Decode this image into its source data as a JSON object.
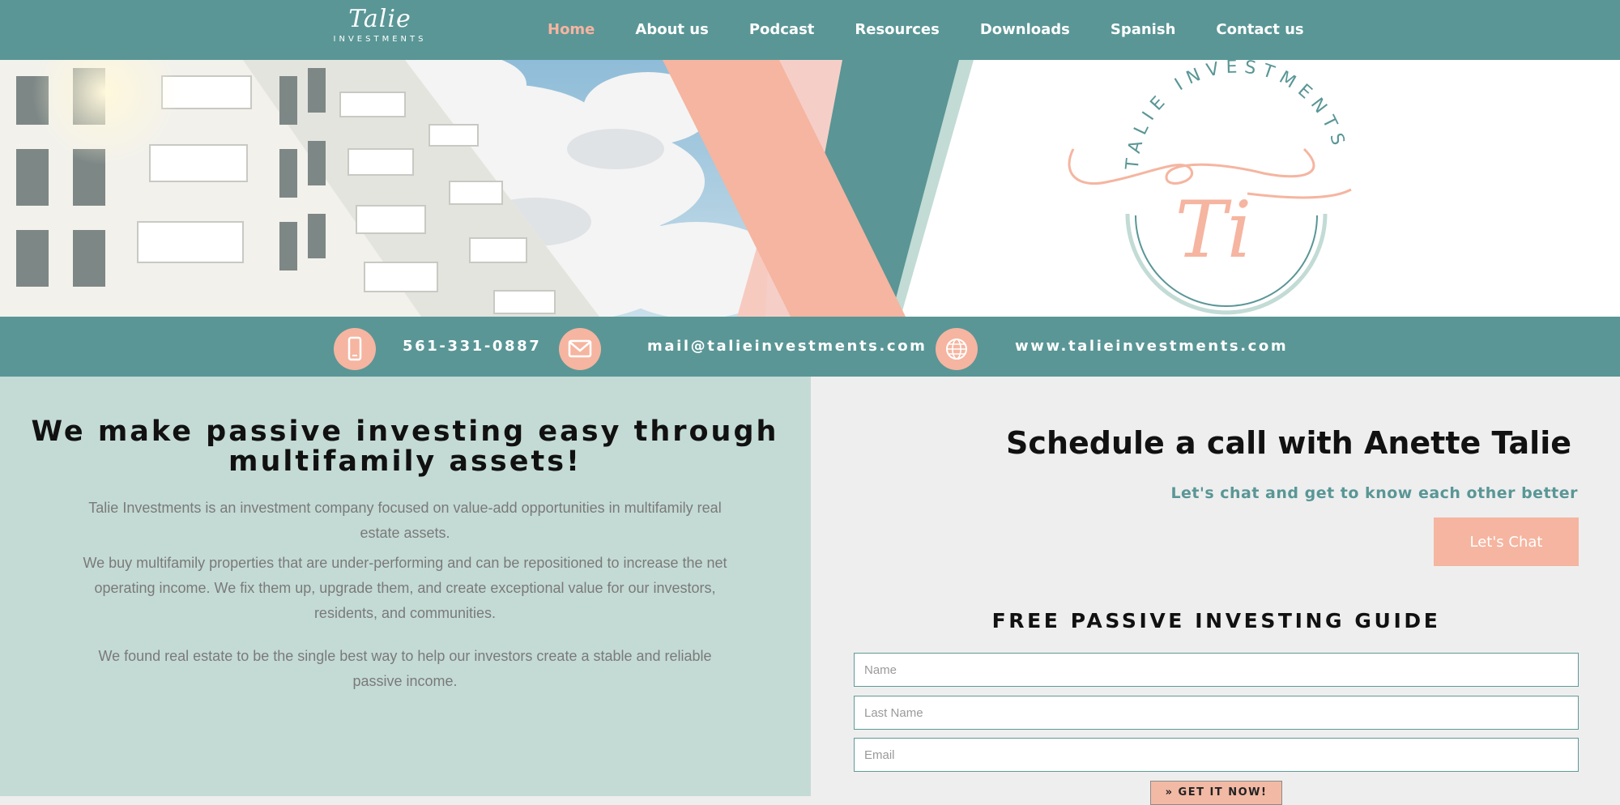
{
  "colors": {
    "teal": "#5a9696",
    "salmon": "#f5b5a0",
    "mint": "#c4dbd5",
    "light_gray": "#eeeeee"
  },
  "header": {
    "logo_script": "Talie",
    "logo_sub": "INVESTMENTS",
    "nav": [
      "Home",
      "About us",
      "Podcast",
      "Resources",
      "Downloads",
      "Spanish",
      "Contact us"
    ],
    "active_nav": "Home"
  },
  "banner": {
    "seal_ring_text": "TALIE INVESTMENTS",
    "seal_monogram": "Ti"
  },
  "contact": {
    "phone_icon": "mobile-phone-icon",
    "phone": "561-331-0887",
    "email_icon": "envelope-icon",
    "email": "mail@talieinvestments.com",
    "web_icon": "globe-icon",
    "website": "www.talieinvestments.com"
  },
  "info": {
    "headline": "We make passive investing easy through multifamily assets!",
    "para1": "Talie Investments is an investment company focused on value-add opportunities in multifamily real estate assets.",
    "para2": "We buy multifamily properties that are under-performing and can be repositioned to increase the net operating income. We fix them up, upgrade them, and create exceptional value for our investors, residents, and communities.",
    "para3": "We found real estate to be the single best way to help our investors create a stable and reliable passive income."
  },
  "schedule": {
    "title": "Schedule a call with Anette Talie",
    "subtitle": "Let's chat and get to know each other better",
    "button": "Let's Chat"
  },
  "guide": {
    "title": "FREE PASSIVE INVESTING GUIDE",
    "name_placeholder": "Name",
    "last_name_placeholder": "Last Name",
    "email_placeholder": "Email",
    "button": "» GET IT NOW!"
  }
}
